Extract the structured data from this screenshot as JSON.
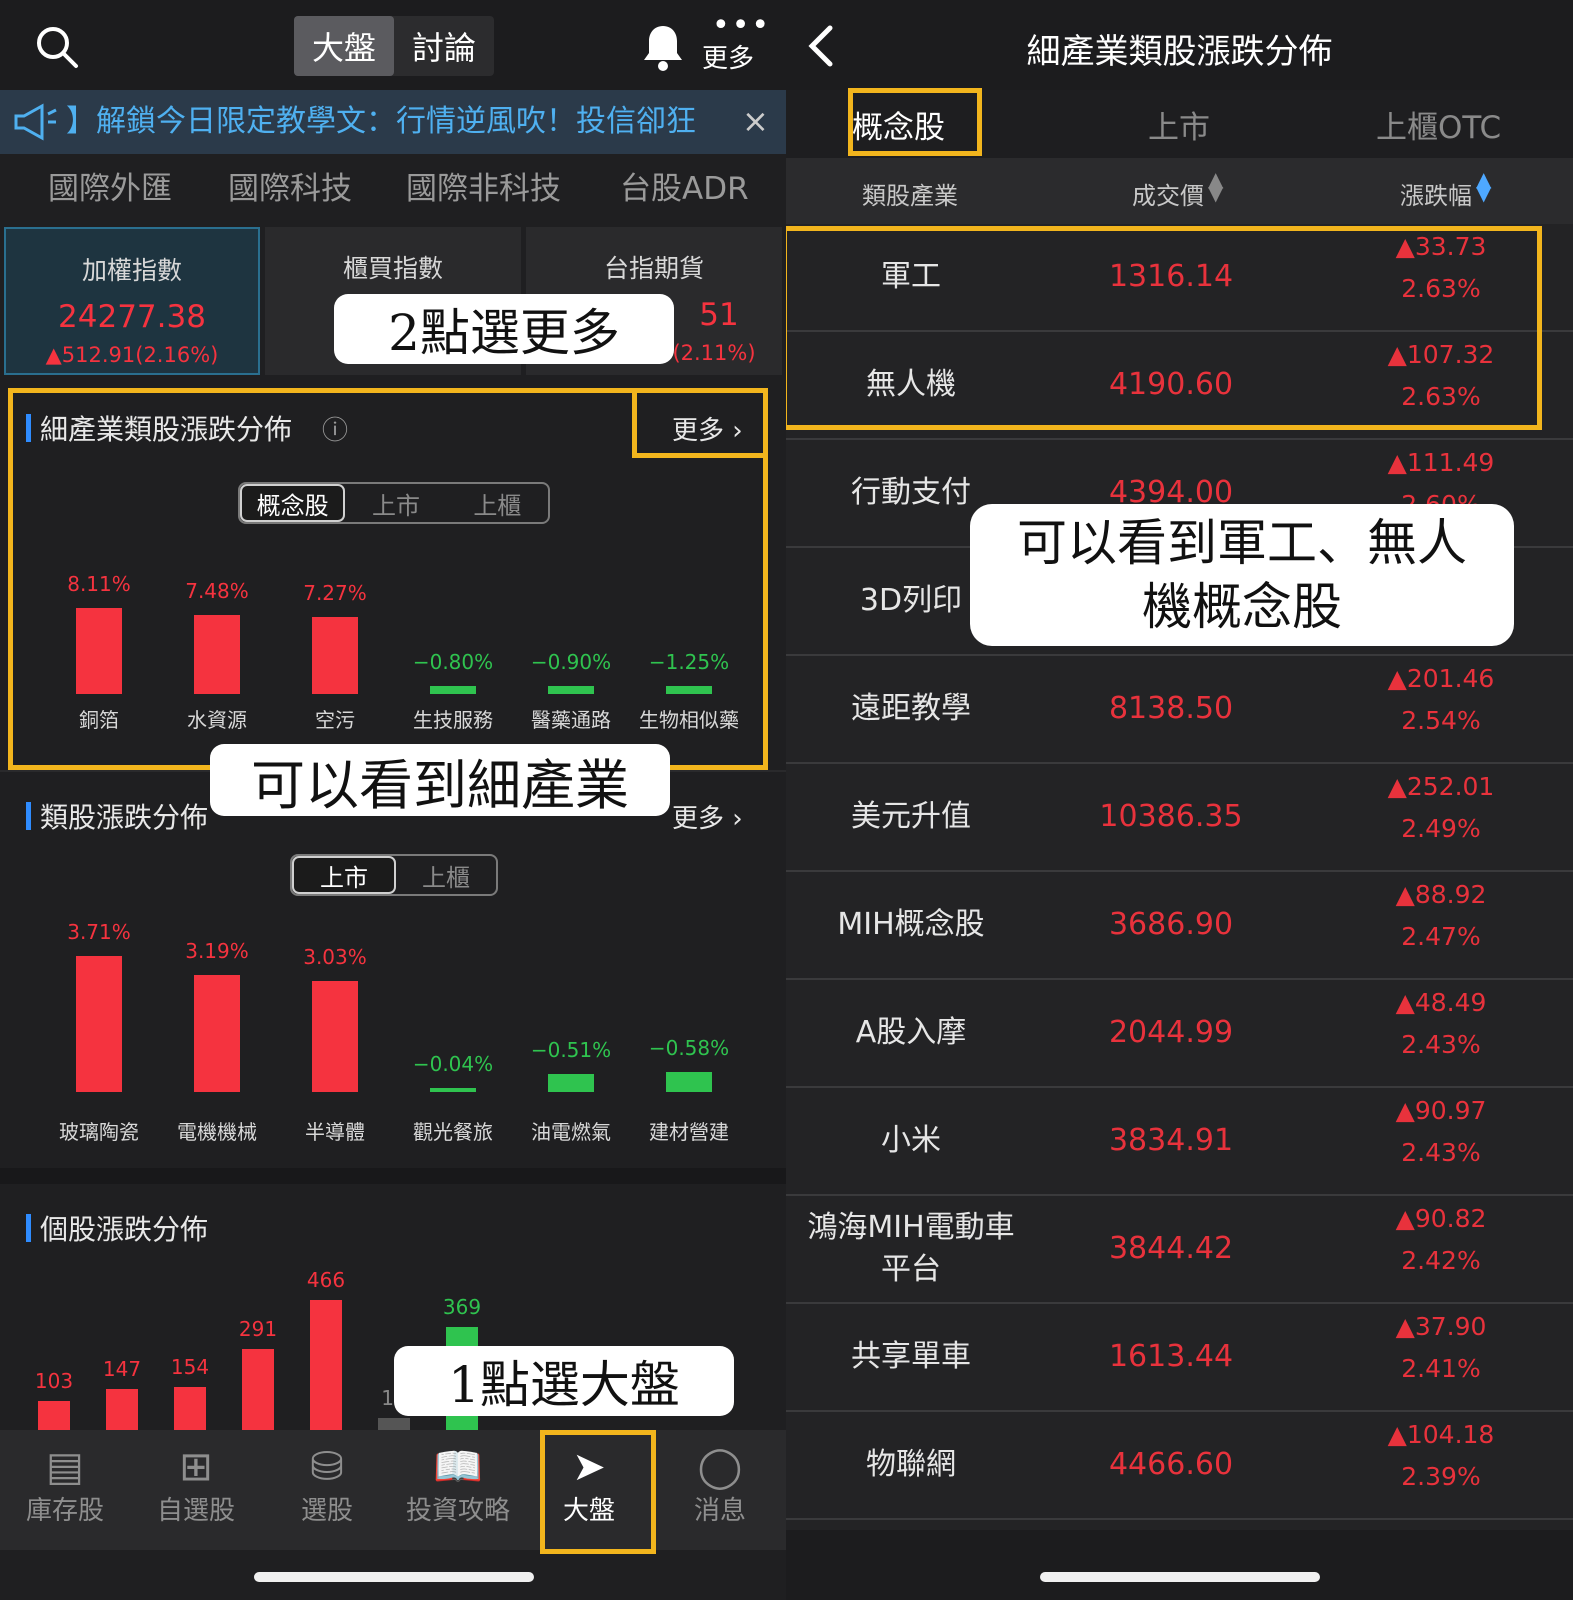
{
  "left": {
    "top_tabs": [
      "大盤",
      "討論"
    ],
    "more_label": "更多",
    "banner_text": "】解鎖今日限定教學文：行情逆風吹！投信卻狂",
    "banner_close": "×",
    "category_tabs": [
      "國際外匯",
      "國際科技",
      "國際非科技",
      "台股ADR"
    ],
    "index_cards": [
      {
        "title": "加權指數",
        "value": "24277.38",
        "change": "▲512.91(2.16%)"
      },
      {
        "title": "櫃買指數",
        "value": "",
        "change": ""
      },
      {
        "title": "台指期貨",
        "value": "51",
        "change": "(2.11%)"
      }
    ],
    "sub_industry": {
      "title": "細產業類股漲跌分佈",
      "info_icon": "ⓘ",
      "more": "更多 ›",
      "segments": [
        "概念股",
        "上市",
        "上櫃"
      ],
      "items": [
        {
          "name": "銅箔",
          "pct": "8.11%",
          "value": 8.11
        },
        {
          "name": "水資源",
          "pct": "7.48%",
          "value": 7.48
        },
        {
          "name": "空污",
          "pct": "7.27%",
          "value": 7.27
        },
        {
          "name": "生技服務",
          "pct": "−0.80%",
          "value": -0.8
        },
        {
          "name": "醫藥通路",
          "pct": "−0.90%",
          "value": -0.9
        },
        {
          "name": "生物相似藥",
          "pct": "−1.25%",
          "value": -1.25
        }
      ]
    },
    "sector": {
      "title": "類股漲跌分佈",
      "more": "更多 ›",
      "segments": [
        "上市",
        "上櫃"
      ],
      "items": [
        {
          "name": "玻璃陶瓷",
          "pct": "3.71%",
          "value": 3.71
        },
        {
          "name": "電機機械",
          "pct": "3.19%",
          "value": 3.19
        },
        {
          "name": "半導體",
          "pct": "3.03%",
          "value": 3.03
        },
        {
          "name": "觀光餐旅",
          "pct": "−0.04%",
          "value": -0.04
        },
        {
          "name": "油電燃氣",
          "pct": "−0.51%",
          "value": -0.51
        },
        {
          "name": "建材營建",
          "pct": "−0.58%",
          "value": -0.58
        }
      ]
    },
    "stock_dist": {
      "title": "個股漲跌分佈",
      "bars": [
        {
          "label": "103",
          "value": 103,
          "color": "red"
        },
        {
          "label": "147",
          "value": 147,
          "color": "red"
        },
        {
          "label": "154",
          "value": 154,
          "color": "red"
        },
        {
          "label": "291",
          "value": 291,
          "color": "red"
        },
        {
          "label": "466",
          "value": 466,
          "color": "red"
        },
        {
          "label": "19",
          "value": 19,
          "color": "gray"
        },
        {
          "label": "369",
          "value": 369,
          "color": "green"
        }
      ]
    },
    "bottom_tabs": [
      "庫存股",
      "自選股",
      "選股",
      "投資攻略",
      "大盤",
      "消息"
    ],
    "callouts": {
      "more": "2點選更多",
      "sub": "可以看到細產業",
      "market": "1點選大盤"
    }
  },
  "right": {
    "title": "細產業類股漲跌分佈",
    "tabs": [
      "概念股",
      "上市",
      "上櫃OTC"
    ],
    "columns": [
      "類股產業",
      "成交價",
      "漲跌幅"
    ],
    "rows": [
      {
        "name": "軍工",
        "price": "1316.14",
        "chg": "▲33.73",
        "pct": "2.63%"
      },
      {
        "name": "無人機",
        "price": "4190.60",
        "chg": "▲107.32",
        "pct": "2.63%"
      },
      {
        "name": "行動支付",
        "price": "4394.00",
        "chg": "▲111.49",
        "pct": "2.60%"
      },
      {
        "name": "3D列印",
        "price": "",
        "chg": "",
        "pct": ""
      },
      {
        "name": "遠距教學",
        "price": "8138.50",
        "chg": "▲201.46",
        "pct": "2.54%"
      },
      {
        "name": "美元升值",
        "price": "10386.35",
        "chg": "▲252.01",
        "pct": "2.49%"
      },
      {
        "name": "MIH概念股",
        "price": "3686.90",
        "chg": "▲88.92",
        "pct": "2.47%"
      },
      {
        "name": "A股入摩",
        "price": "2044.99",
        "chg": "▲48.49",
        "pct": "2.43%"
      },
      {
        "name": "小米",
        "price": "3834.91",
        "chg": "▲90.97",
        "pct": "2.43%"
      },
      {
        "name": "鴻海MIH電動車平台",
        "price": "3844.42",
        "chg": "▲90.82",
        "pct": "2.42%"
      },
      {
        "name": "共享單車",
        "price": "1613.44",
        "chg": "▲37.90",
        "pct": "2.41%"
      },
      {
        "name": "物聯網",
        "price": "4466.60",
        "chg": "▲104.18",
        "pct": "2.39%"
      }
    ],
    "callout": "可以看到軍工、無人機概念股"
  },
  "colors": {
    "up": "#f5333f",
    "down": "#2fc34f",
    "highlight": "#f2b51d",
    "accent": "#2f8cff"
  }
}
